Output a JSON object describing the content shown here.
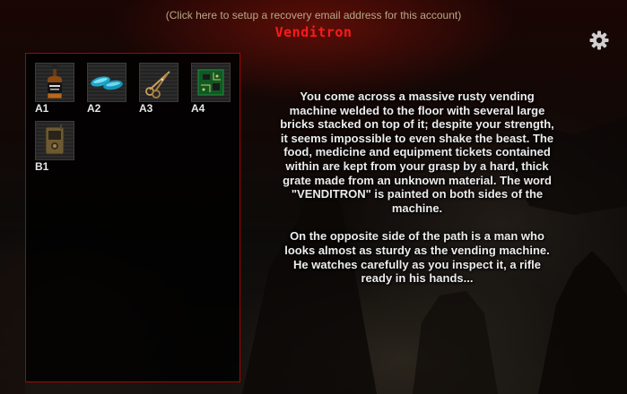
{
  "header": {
    "recovery_link": "(Click here to setup a recovery email address for this account)",
    "title": "Venditron"
  },
  "settings": {
    "icon": "gear-icon"
  },
  "inventory": {
    "items": [
      {
        "code": "A1",
        "icon": "whiskey-bottle-icon"
      },
      {
        "code": "A2",
        "icon": "blue-pills-icon"
      },
      {
        "code": "A3",
        "icon": "scissors-icon"
      },
      {
        "code": "A4",
        "icon": "circuit-board-icon"
      },
      {
        "code": "B1",
        "icon": "radio-device-icon"
      }
    ]
  },
  "story": {
    "paragraphs": [
      "You come across a massive rusty vending machine welded to the floor with several large bricks stacked on top of it; despite your strength, it seems impossible to even shake the beast. The food, medicine and equipment tickets contained within are kept from your grasp by a hard, thick grate made from an unknown material. The word \"VENDITRON\" is painted on both sides of the machine.",
      "On the opposite side of the path is a man who looks almost as sturdy as the vending machine. He watches carefully as you inspect it, a rifle ready in his hands..."
    ]
  },
  "colors": {
    "title": "#ff1a1a",
    "panel_border": "#b00000",
    "link": "#b8a888",
    "text": "#ececec"
  }
}
